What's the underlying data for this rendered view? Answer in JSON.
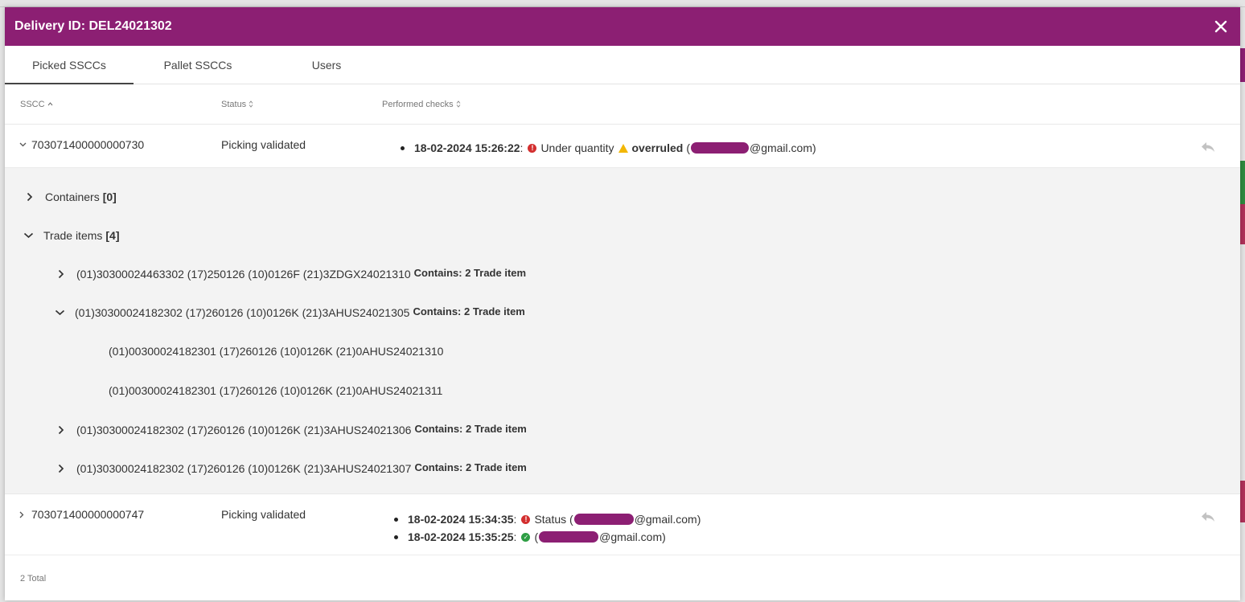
{
  "modal": {
    "title": "Delivery ID: DEL24021302",
    "close_icon": "close-icon"
  },
  "tabs": [
    {
      "label": "Picked SSCCs",
      "active": true
    },
    {
      "label": "Pallet SSCCs",
      "active": false
    },
    {
      "label": "Users",
      "active": false
    }
  ],
  "columns": {
    "sscc": "SSCC",
    "status": "Status",
    "checks": "Performed checks"
  },
  "rows": [
    {
      "sscc": "703071400000000730",
      "status": "Picking validated",
      "expanded": true,
      "checks": [
        {
          "timestamp": "18-02-2024 15:26:22",
          "separator": ":",
          "icon": "error-icon",
          "text": "Under quantity",
          "warn_icon": "warning-icon",
          "strong": "overruled",
          "email_prefix": "(",
          "email_suffix": "@gmail.com)"
        }
      ]
    },
    {
      "sscc": "703071400000000747",
      "status": "Picking validated",
      "expanded": false,
      "checks": [
        {
          "timestamp": "18-02-2024 15:34:35",
          "separator": ":",
          "icon": "error-icon",
          "text": "Status (",
          "email_suffix": "@gmail.com)"
        },
        {
          "timestamp": "18-02-2024 15:35:25",
          "separator": ":",
          "icon": "success-icon",
          "text": "(",
          "email_suffix": "@gmail.com)"
        }
      ]
    }
  ],
  "detail": {
    "containers": {
      "label": "Containers",
      "count": "[0]"
    },
    "trade_items": {
      "label": "Trade items",
      "count": "[4]"
    },
    "items": [
      {
        "code": "(01)30300024463302 (17)250126 (10)0126F (21)3ZDGX24021310",
        "contains": "Contains: 2 Trade item",
        "expanded": false
      },
      {
        "code": "(01)30300024182302 (17)260126 (10)0126K (21)3AHUS24021305",
        "contains": "Contains: 2 Trade item",
        "expanded": true,
        "children": [
          "(01)00300024182301 (17)260126 (10)0126K (21)0AHUS24021310",
          "(01)00300024182301 (17)260126 (10)0126K (21)0AHUS24021311"
        ]
      },
      {
        "code": "(01)30300024182302 (17)260126 (10)0126K (21)3AHUS24021306",
        "contains": "Contains: 2 Trade item",
        "expanded": false
      },
      {
        "code": "(01)30300024182302 (17)260126 (10)0126K (21)3AHUS24021307",
        "contains": "Contains: 2 Trade item",
        "expanded": false
      }
    ]
  },
  "footer": {
    "total": "2 Total"
  },
  "colors": {
    "brand": "#8c1f73",
    "error": "#d32f2f",
    "warning": "#f2b705",
    "success": "#2e9e44"
  }
}
